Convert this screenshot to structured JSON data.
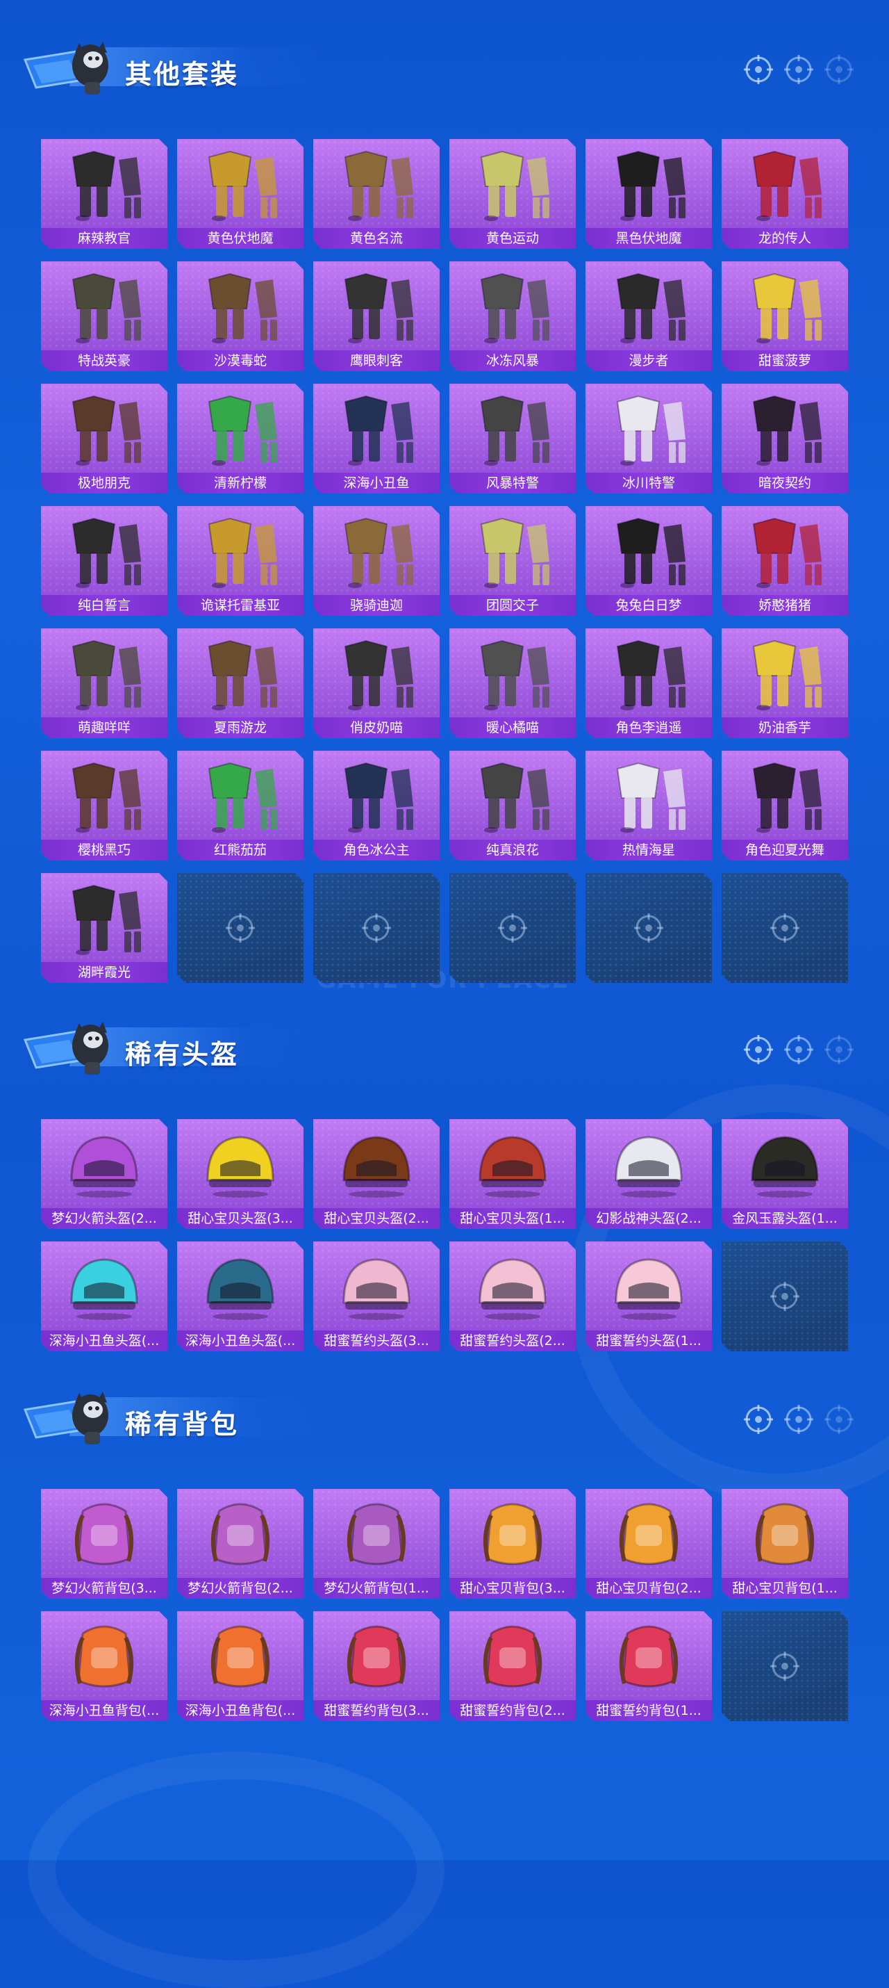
{
  "colors": {
    "background": "#1160da",
    "card_fill": "#a25ee2",
    "label_band": "#7b2fd0",
    "empty_slot": "#1c447d"
  },
  "watermark": "GAME FOR PEACE",
  "sections": [
    {
      "title": "其他套装",
      "items": [
        "麻辣教官",
        "黄色伏地魔",
        "黄色名流",
        "黄色运动",
        "黑色伏地魔",
        "龙的传人",
        "特战英豪",
        "沙漠毒蛇",
        "鹰眼刺客",
        "冰冻风暴",
        "漫步者",
        "甜蜜菠萝",
        "极地朋克",
        "清新柠檬",
        "深海小丑鱼",
        "风暴特警",
        "冰川特警",
        "暗夜契约",
        "纯白誓言",
        "诡谋托雷基亚",
        "骁骑迪迦",
        "团圆交子",
        "兔兔白日梦",
        "娇憨猪猪",
        "萌趣咩咩",
        "夏雨游龙",
        "俏皮奶喵",
        "暖心橘喵",
        "角色李逍遥",
        "奶油香芋",
        "樱桃黑巧",
        "红熊茄茄",
        "角色冰公主",
        "纯真浪花",
        "热情海星",
        "角色迎夏光舞",
        "湖畔霞光"
      ],
      "empty_slots": 5
    },
    {
      "title": "稀有头盔",
      "items": [
        "梦幻火箭头盔(2...",
        "甜心宝贝头盔(3...",
        "甜心宝贝头盔(2...",
        "甜心宝贝头盔(1...",
        "幻影战神头盔(2...",
        "金风玉露头盔(1...",
        "深海小丑鱼头盔(...",
        "深海小丑鱼头盔(...",
        "甜蜜誓约头盔(3...",
        "甜蜜誓约头盔(2...",
        "甜蜜誓约头盔(1..."
      ],
      "empty_slots": 1
    },
    {
      "title": "稀有背包",
      "items": [
        "梦幻火箭背包(3...",
        "梦幻火箭背包(2...",
        "梦幻火箭背包(1...",
        "甜心宝贝背包(3...",
        "甜心宝贝背包(2...",
        "甜心宝贝背包(1...",
        "深海小丑鱼背包(...",
        "深海小丑鱼背包(...",
        "甜蜜誓约背包(3...",
        "甜蜜誓约背包(2...",
        "甜蜜誓约背包(1..."
      ],
      "empty_slots": 1
    }
  ]
}
